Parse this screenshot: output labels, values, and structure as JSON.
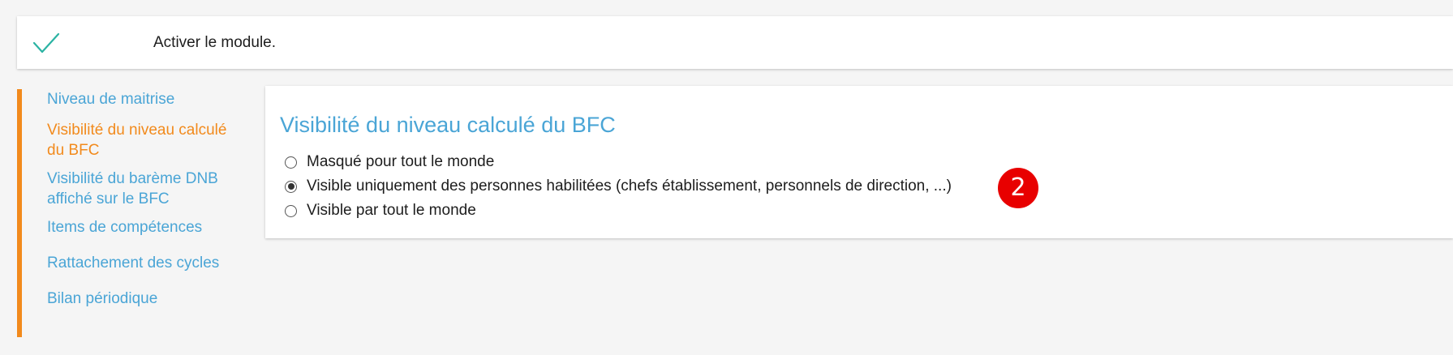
{
  "module": {
    "icon": "check-icon",
    "label": "Activer le module.",
    "check_color": "#2bb3a3"
  },
  "sidebar": {
    "accent_color": "#f28a1c",
    "items": [
      {
        "label": "Niveau de maitrise",
        "active": false
      },
      {
        "label": "Visibilité du niveau calculé du BFC",
        "active": true
      },
      {
        "label": "Visibilité du barème DNB affiché sur le BFC",
        "active": false
      },
      {
        "label": "Items de compétences",
        "active": false
      },
      {
        "label": "Rattachement des cycles",
        "active": false
      },
      {
        "label": "Bilan périodique",
        "active": false
      }
    ]
  },
  "panel": {
    "title": "Visibilité du niveau calculé du BFC",
    "options": [
      {
        "label": "Masqué pour tout le monde",
        "checked": false
      },
      {
        "label": "Visible uniquement des personnes habilitées (chefs établissement, personnels de direction, ...)",
        "checked": true
      },
      {
        "label": "Visible par tout le monde",
        "checked": false
      }
    ]
  },
  "badge": {
    "label": "2",
    "color": "#e80000"
  }
}
